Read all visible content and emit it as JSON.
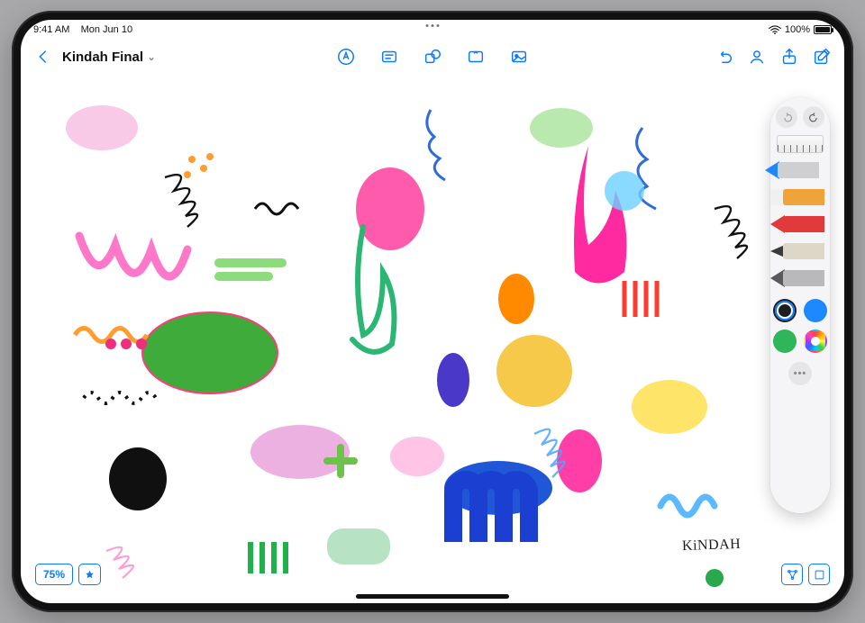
{
  "status": {
    "time": "9:41 AM",
    "date": "Mon Jun 10",
    "battery_pct": "100%"
  },
  "doc": {
    "title": "Kindah Final"
  },
  "signature": "KiNDAH",
  "zoom": {
    "label": "75%"
  },
  "toolbar": {
    "back": "Back",
    "center": {
      "markup": "Markup",
      "text_box": "Text box",
      "shapes": "Shapes",
      "table": "Table",
      "media": "Media"
    },
    "right": {
      "undo": "Undo",
      "collab": "Collaborate",
      "share": "Share",
      "compose": "New"
    }
  },
  "bottom_right": {
    "navigator": "Navigator",
    "fit": "Zoom to fit"
  },
  "palette": {
    "undo": "Undo",
    "redo": "Redo",
    "ruler": "Ruler",
    "tools": [
      {
        "id": "pen",
        "label": "Pen",
        "color": "#1e88ff",
        "selected": true
      },
      {
        "id": "marker",
        "label": "Marker",
        "color": "#f0a33a",
        "selected": false
      },
      {
        "id": "crayon",
        "label": "Crayon",
        "color": "#e03a3a",
        "selected": false
      },
      {
        "id": "pencil",
        "label": "Pencil",
        "color": "#3a3a3a",
        "selected": false
      },
      {
        "id": "fountain",
        "label": "Fountain pen",
        "color": "#5a5a5c",
        "selected": false
      }
    ],
    "colors": [
      {
        "hex": "#1e1e1e",
        "selected": true
      },
      {
        "hex": "#1e88ff",
        "selected": false
      },
      {
        "hex": "#2fb65a",
        "selected": false
      },
      {
        "hex": "picker",
        "selected": false
      }
    ],
    "more": "More"
  }
}
